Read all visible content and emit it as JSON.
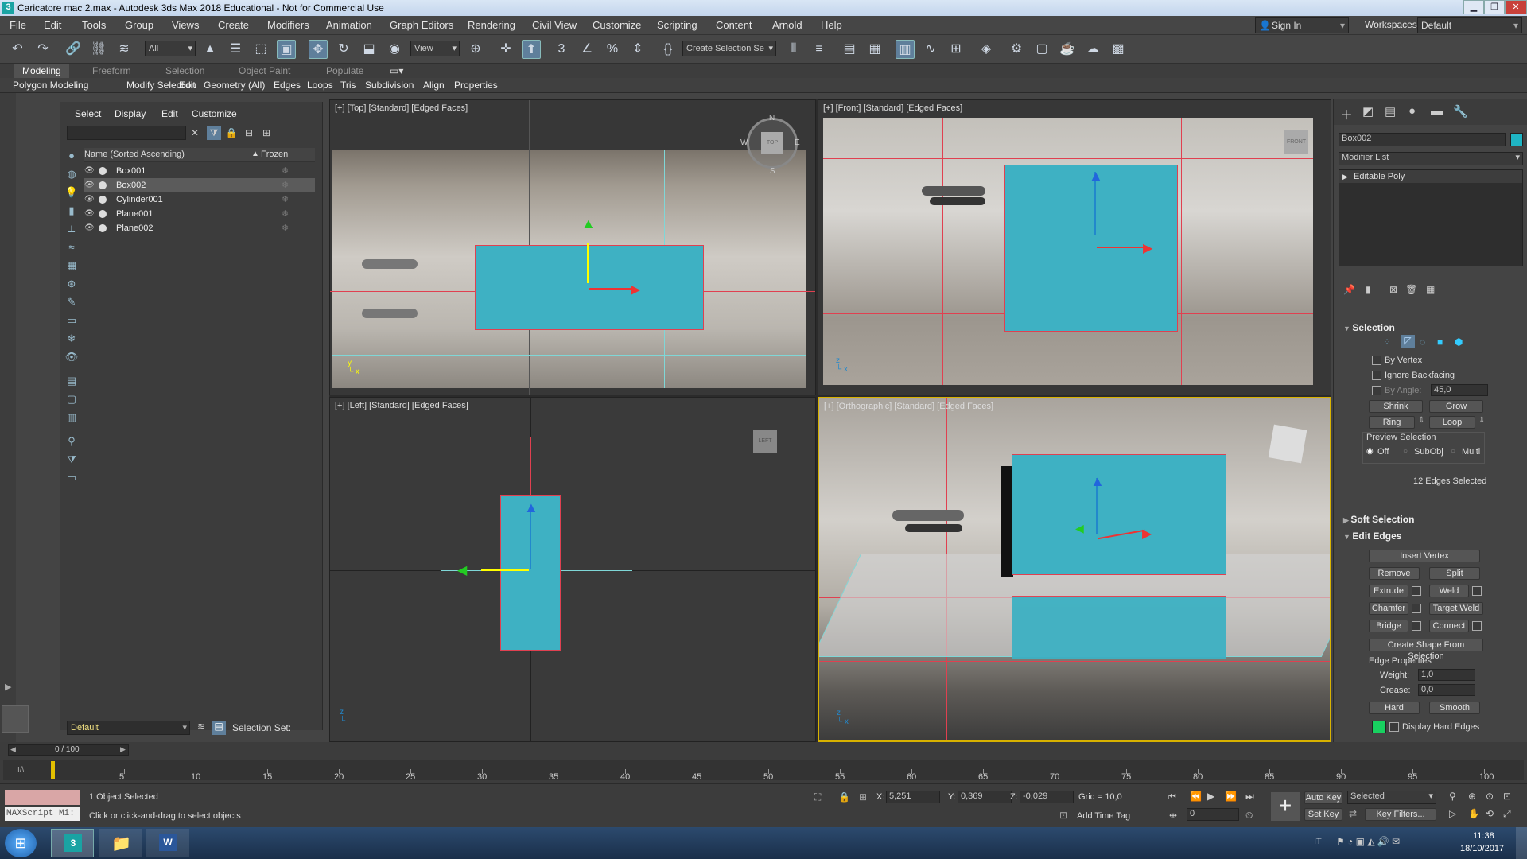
{
  "window": {
    "title": "Caricatore mac 2.max - Autodesk 3ds Max 2018 Educational - Not for Commercial Use",
    "app_icon": "3"
  },
  "menu": [
    "File",
    "Edit",
    "Tools",
    "Group",
    "Views",
    "Create",
    "Modifiers",
    "Animation",
    "Graph Editors",
    "Rendering",
    "Civil View",
    "Customize",
    "Scripting",
    "Content",
    "Arnold",
    "Help"
  ],
  "account": {
    "sign_in": "Sign In",
    "workspaces_label": "Workspaces:",
    "workspace": "Default"
  },
  "toolbar": {
    "filter": "All",
    "ref_coord": "View",
    "selection_set": "Create Selection Se"
  },
  "ribbon": {
    "tabs": [
      "Modeling",
      "Freeform",
      "Selection",
      "Object Paint",
      "Populate"
    ],
    "subtabs": [
      "Polygon Modeling",
      "Modify Selection",
      "Edit",
      "Geometry (All)",
      "Edges",
      "Loops",
      "Tris",
      "Subdivision",
      "Align",
      "Properties"
    ]
  },
  "scene_explorer": {
    "menu": [
      "Select",
      "Display",
      "Edit",
      "Customize"
    ],
    "column_name": "Name (Sorted Ascending)",
    "column_frozen": "Frozen",
    "items": [
      {
        "name": "Box001",
        "selected": false
      },
      {
        "name": "Box002",
        "selected": true
      },
      {
        "name": "Cylinder001",
        "selected": false
      },
      {
        "name": "Plane001",
        "selected": false
      },
      {
        "name": "Plane002",
        "selected": false
      }
    ],
    "layer": "Default",
    "selection_set_label": "Selection Set:"
  },
  "viewports": {
    "top": "[+] [Top] [Standard] [Edged Faces]",
    "front": "[+] [Front] [Standard] [Edged Faces]",
    "left": "[+] [Left] [Standard] [Edged Faces]",
    "ortho": "[+] [Orthographic] [Standard] [Edged Faces]",
    "compass": {
      "n": "N",
      "s": "S",
      "e": "E",
      "w": "W"
    },
    "cube_top": "TOP",
    "cube_front": "FRONT",
    "cube_left": "LEFT"
  },
  "command_panel": {
    "object_name": "Box002",
    "modifier_list": "Modifier List",
    "stack_item": "Editable Poly",
    "selection": {
      "title": "Selection",
      "by_vertex": "By Vertex",
      "ignore_backfacing": "Ignore Backfacing",
      "by_angle": "By Angle:",
      "angle_value": "45,0",
      "shrink": "Shrink",
      "grow": "Grow",
      "ring": "Ring",
      "loop": "Loop",
      "preview_title": "Preview Selection",
      "preview_options": [
        "Off",
        "SubObj",
        "Multi"
      ],
      "status": "12 Edges Selected"
    },
    "soft_selection": "Soft Selection",
    "edit_edges": {
      "title": "Edit Edges",
      "insert_vertex": "Insert Vertex",
      "remove": "Remove",
      "split": "Split",
      "extrude": "Extrude",
      "weld": "Weld",
      "chamfer": "Chamfer",
      "target_weld": "Target Weld",
      "bridge": "Bridge",
      "connect": "Connect",
      "create_shape": "Create Shape From Selection",
      "edge_properties": "Edge Properties",
      "weight_label": "Weight:",
      "weight": "1,0",
      "crease_label": "Crease:",
      "crease": "0,0",
      "hard": "Hard",
      "smooth": "Smooth",
      "display_hard_edges": "Display Hard Edges"
    },
    "color_swatch": "#1fb5c4",
    "hard_edge_color": "#18d060"
  },
  "timeline": {
    "frame": "0 / 100",
    "ticks": [
      "5",
      "10",
      "15",
      "20",
      "25",
      "30",
      "35",
      "40",
      "45",
      "50",
      "55",
      "60",
      "65",
      "70",
      "75",
      "80",
      "85",
      "90",
      "95",
      "100"
    ]
  },
  "status": {
    "maxscript": "MAXScript Mi:",
    "objects_selected": "1 Object Selected",
    "prompt": "Click or click-and-drag to select objects",
    "x_label": "X:",
    "x": "5,251",
    "y_label": "Y:",
    "y": "0,369",
    "z_label": "Z:",
    "z": "-0,029",
    "grid": "Grid = 10,0",
    "add_time_tag": "Add Time Tag",
    "auto_key": "Auto Key",
    "selected": "Selected",
    "set_key": "Set Key",
    "key_filters": "Key Filters...",
    "frame_field": "0"
  },
  "taskbar": {
    "lang": "IT",
    "time": "11:38",
    "date": "18/10/2017"
  }
}
